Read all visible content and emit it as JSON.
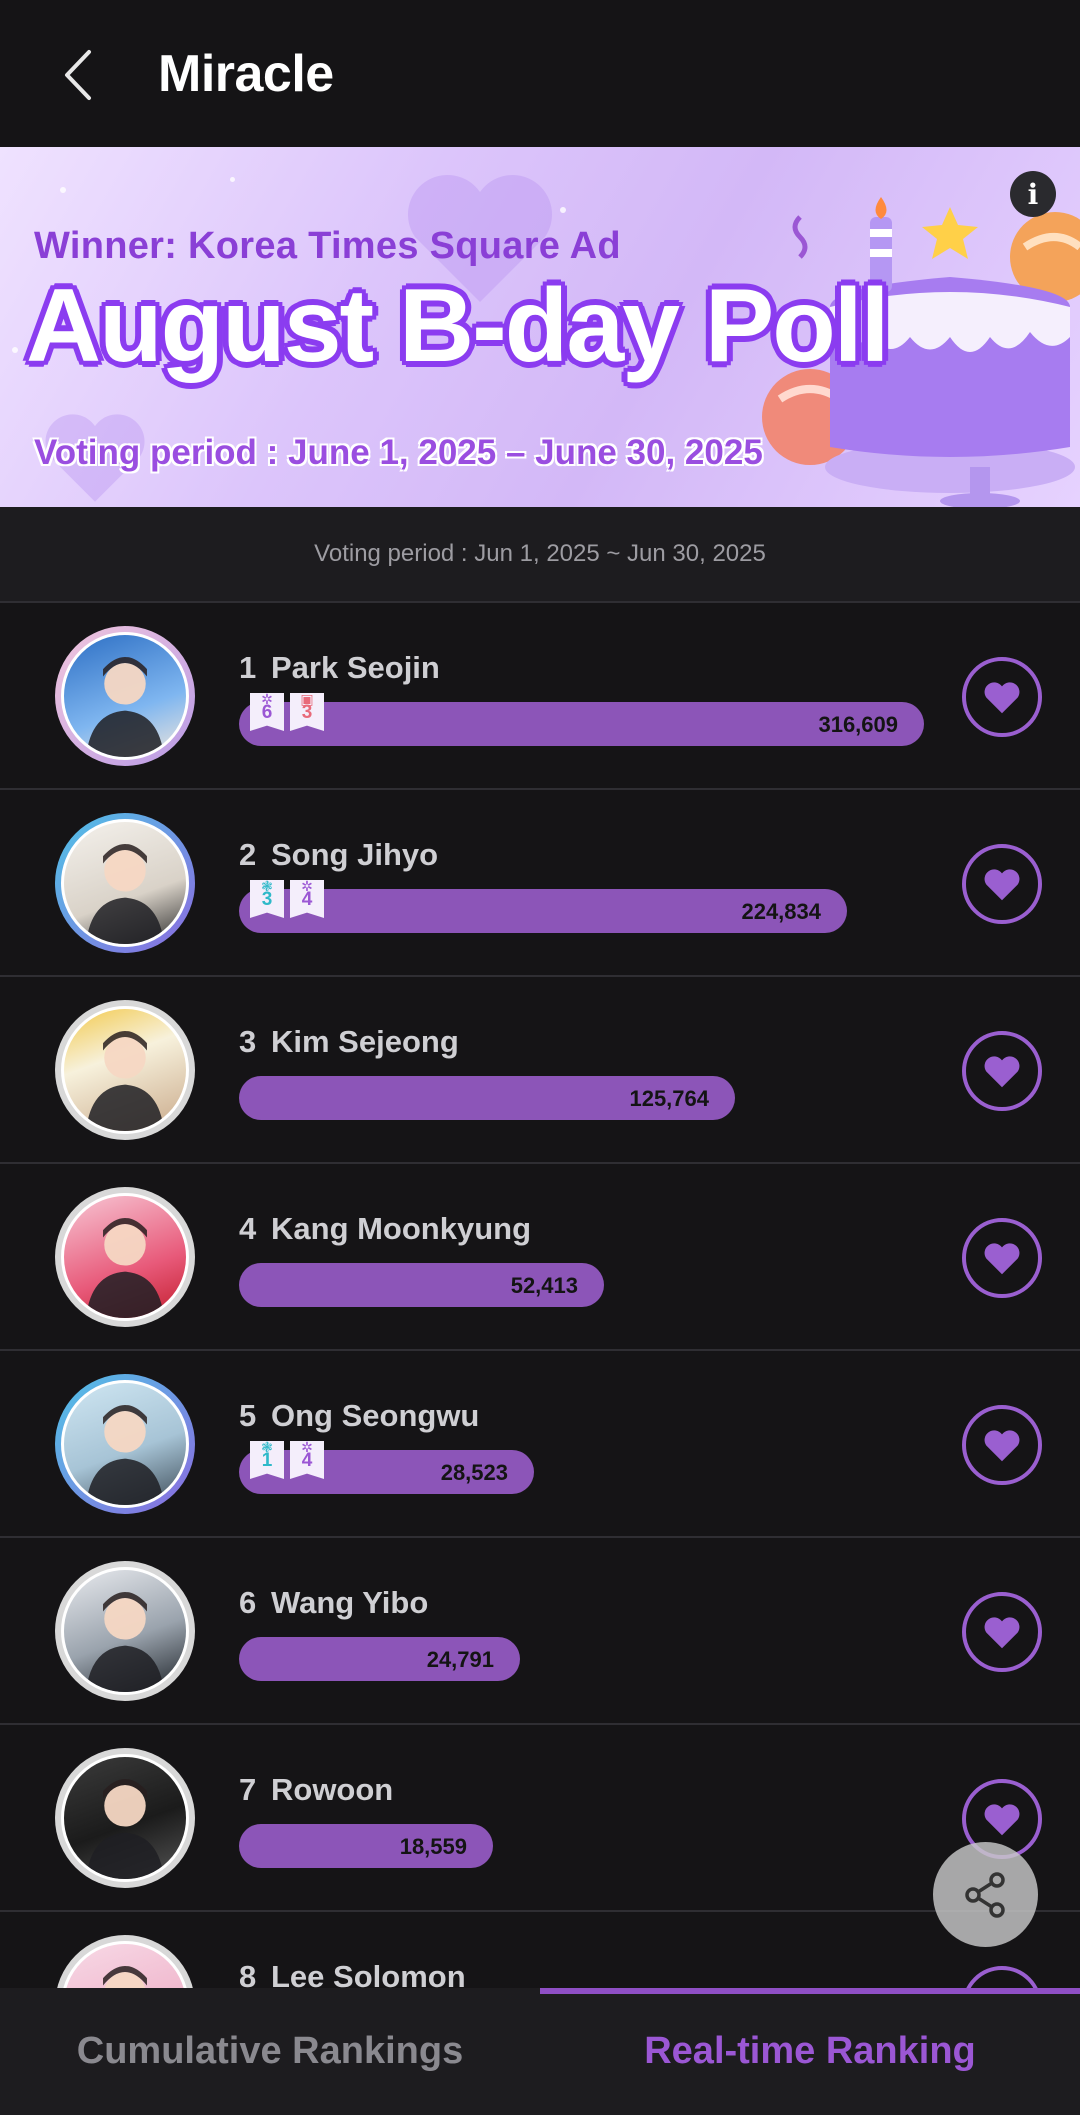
{
  "header": {
    "title": "Miracle"
  },
  "banner": {
    "winner": "Winner: Korea Times Square Ad",
    "title": "August B-day Poll",
    "period": "Voting period : June 1, 2025 – June 30, 2025"
  },
  "period_strip": "Voting period :  Jun 1, 2025 ~ Jun 30, 2025",
  "colors": {
    "accent": "#8c55b8",
    "tab_active": "#9b57d4",
    "background": "#151416"
  },
  "rankings": [
    {
      "rank": "1",
      "name": "Park Seojin",
      "votes": "316,609",
      "value": 316609,
      "badges": [
        {
          "num": "6",
          "color": "#9b57d4",
          "icon": "✲"
        },
        {
          "num": "3",
          "color": "#e86a7a",
          "icon": "▣"
        }
      ],
      "ring": "#d9a6d6"
    },
    {
      "rank": "2",
      "name": "Song Jihyo",
      "votes": "224,834",
      "value": 224834,
      "badges": [
        {
          "num": "3",
          "color": "#2fb9c9",
          "icon": "❃"
        },
        {
          "num": "4",
          "color": "#9b57d4",
          "icon": "✲"
        }
      ],
      "ring": "#5aa8e6"
    },
    {
      "rank": "3",
      "name": "Kim Sejeong",
      "votes": "125,764",
      "value": 125764,
      "badges": [],
      "ring": "#d8d8d8"
    },
    {
      "rank": "4",
      "name": "Kang Moonkyung",
      "votes": "52,413",
      "value": 52413,
      "badges": [],
      "ring": "#d8d8d8"
    },
    {
      "rank": "5",
      "name": "Ong Seongwu",
      "votes": "28,523",
      "value": 28523,
      "badges": [
        {
          "num": "1",
          "color": "#2fb9c9",
          "icon": "❃"
        },
        {
          "num": "4",
          "color": "#9b57d4",
          "icon": "✲"
        }
      ],
      "ring": "#5aa8e6"
    },
    {
      "rank": "6",
      "name": "Wang Yibo",
      "votes": "24,791",
      "value": 24791,
      "badges": [],
      "ring": "#d8d8d8"
    },
    {
      "rank": "7",
      "name": "Rowoon",
      "votes": "18,559",
      "value": 18559,
      "badges": [],
      "ring": "#d8d8d8"
    },
    {
      "rank": "8",
      "name": "Lee Solomon",
      "votes": "",
      "value": 0,
      "badges": [],
      "ring": "#d8d8d8"
    }
  ],
  "tabs": {
    "cumulative": "Cumulative Rankings",
    "realtime": "Real-time Ranking",
    "active": "realtime"
  },
  "icons": {
    "back": "chevron-left-icon",
    "info": "info-icon",
    "vote": "heart-icon",
    "share": "share-icon"
  }
}
